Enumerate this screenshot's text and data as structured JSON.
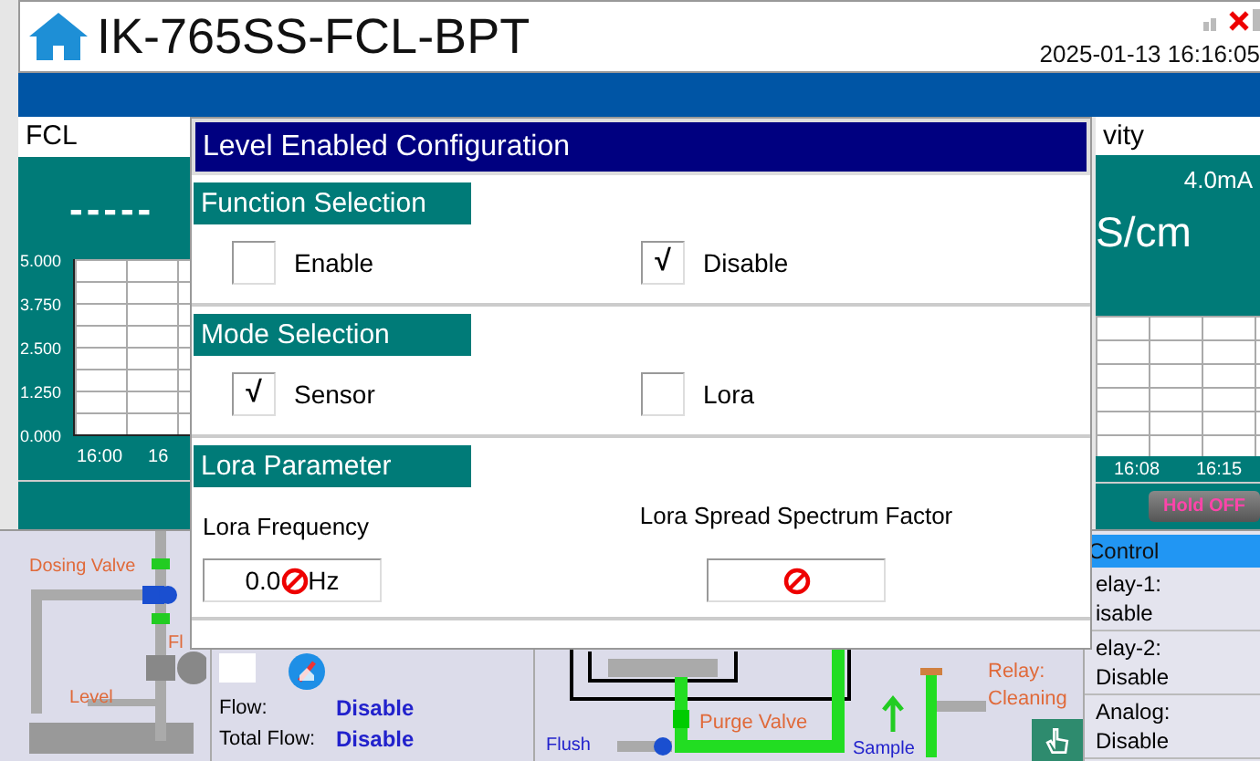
{
  "header": {
    "title": "IK-765SS-FCL-BPT",
    "datetime": "2025-01-13 16:16:05"
  },
  "left_panel": {
    "title": "FCL",
    "reading": "-----",
    "y_ticks": [
      "5.000",
      "3.750",
      "2.500",
      "1.250",
      "0.000"
    ],
    "x_ticks": [
      "16:00",
      "16"
    ]
  },
  "right_panel": {
    "title": "vity",
    "output": "4.0mA",
    "unit": "S/cm",
    "x_ticks": [
      "16:08",
      "16:15"
    ],
    "hold_button": "Hold OFF"
  },
  "process_left": {
    "labels": [
      "Dosing Valve",
      "Fl",
      "Level"
    ]
  },
  "flow_panel": {
    "rows": [
      {
        "label": "Flow:",
        "value": "Disable"
      },
      {
        "label": "Total Flow:",
        "value": "Disable"
      }
    ]
  },
  "process_center": {
    "purge": "Purge Valve",
    "flush": "Flush",
    "sample": "Sample",
    "relay": "Relay: Cleaning"
  },
  "control_list": {
    "title": "Control",
    "items": [
      {
        "label": "elay-1:",
        "value": "isable"
      },
      {
        "label": "elay-2:",
        "value": "Disable"
      },
      {
        "label": "Analog:",
        "value": "Disable"
      }
    ]
  },
  "dialog": {
    "title": "Level Enabled Configuration",
    "check_mark": "√",
    "sections": [
      {
        "kind": "options",
        "title": "Function Selection",
        "options": [
          {
            "label": "Enable",
            "checked": false
          },
          {
            "label": "Disable",
            "checked": true
          }
        ]
      },
      {
        "kind": "options",
        "title": "Mode Selection",
        "options": [
          {
            "label": "Sensor",
            "checked": true
          },
          {
            "label": "Lora",
            "checked": false
          }
        ]
      },
      {
        "kind": "fields",
        "title": "Lora Parameter",
        "fields": [
          {
            "label": "Lora Frequency",
            "value_start": "0.0",
            "value_end": "Hz"
          },
          {
            "label": "Lora Spread Spectrum Factor"
          }
        ]
      }
    ]
  }
}
